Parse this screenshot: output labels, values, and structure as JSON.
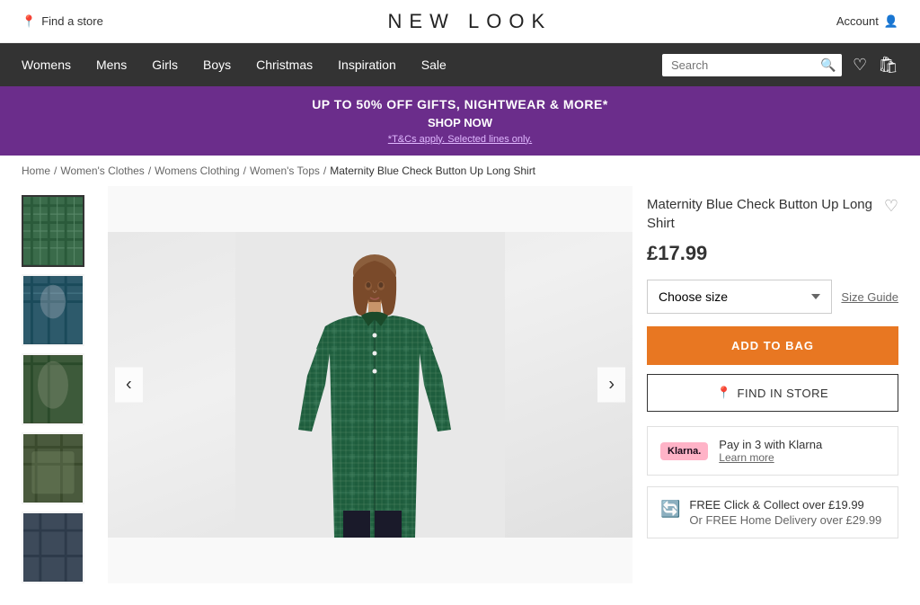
{
  "topBar": {
    "findStore": "Find a store",
    "logo": "NEW LOOK",
    "account": "Account"
  },
  "nav": {
    "links": [
      "Womens",
      "Mens",
      "Girls",
      "Boys",
      "Christmas",
      "Inspiration",
      "Sale"
    ],
    "searchPlaceholder": "Search"
  },
  "promo": {
    "line1": "UP TO 50% OFF GIFTS, NIGHTWEAR & MORE*",
    "line2": "SHOP NOW",
    "terms": "*T&Cs apply. Selected lines only."
  },
  "breadcrumb": {
    "items": [
      "Home",
      "Women's Clothes",
      "Womens Clothing",
      "Women's Tops"
    ],
    "current": "Maternity Blue Check Button Up Long Shirt"
  },
  "product": {
    "title": "Maternity Blue Check Button Up Long Shirt",
    "price": "£17.99",
    "sizeLabel": "Choose size",
    "sizeGuide": "Size Guide",
    "addToBag": "ADD TO BAG",
    "findInStore": "FIND IN STORE",
    "klarna": {
      "logo": "Klarna.",
      "title": "Pay in 3 with Klarna",
      "learn": "Learn more"
    },
    "delivery": {
      "line1": "FREE Click & Collect over £19.99",
      "line2": "Or FREE Home Delivery over £29.99"
    }
  },
  "icons": {
    "location": "📍",
    "account": "👤",
    "search": "🔍",
    "wishlistEmpty": "♡",
    "wishlistNav": "♡",
    "bag": "🛍",
    "arrowLeft": "‹",
    "arrowRight": "›",
    "locationPin": "📍",
    "chevronDown": "▾",
    "delivery": "🔄"
  }
}
